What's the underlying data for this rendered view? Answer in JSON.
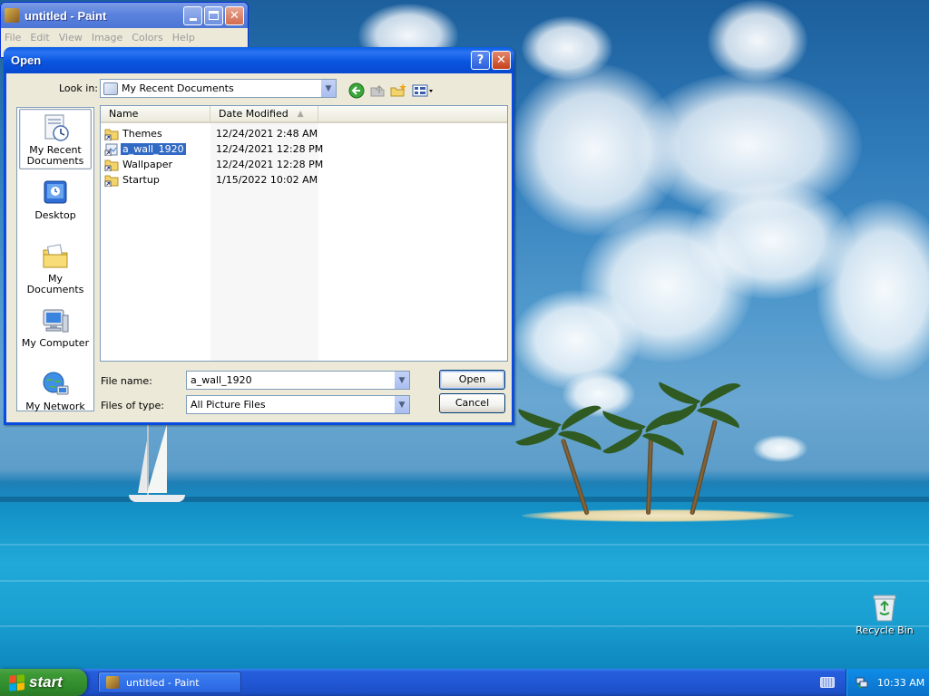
{
  "desktop": {
    "recycle_bin_label": "Recycle Bin"
  },
  "paint_window": {
    "title": "untitled - Paint",
    "menu": [
      "File",
      "Edit",
      "View",
      "Image",
      "Colors",
      "Help"
    ]
  },
  "open_dialog": {
    "title": "Open",
    "look_in_label": "Look in:",
    "look_in_value": "My Recent Documents",
    "places": [
      {
        "label": "My Recent Documents",
        "icon": "recent-documents-icon"
      },
      {
        "label": "Desktop",
        "icon": "desktop-icon"
      },
      {
        "label": "My Documents",
        "icon": "my-documents-icon"
      },
      {
        "label": "My Computer",
        "icon": "my-computer-icon"
      },
      {
        "label": "My Network",
        "icon": "my-network-icon"
      }
    ],
    "columns": {
      "name": "Name",
      "date_modified": "Date Modified"
    },
    "files": [
      {
        "name": "Themes",
        "date": "12/24/2021 2:48 AM",
        "selected": false
      },
      {
        "name": "a_wall_1920",
        "date": "12/24/2021 12:28 PM",
        "selected": true
      },
      {
        "name": "Wallpaper",
        "date": "12/24/2021 12:28 PM",
        "selected": false
      },
      {
        "name": "Startup",
        "date": "1/15/2022 10:02 AM",
        "selected": false
      }
    ],
    "file_name_label": "File name:",
    "file_name_value": "a_wall_1920",
    "files_of_type_label": "Files of type:",
    "files_of_type_value": "All Picture Files",
    "open_button": "Open",
    "cancel_button": "Cancel"
  },
  "taskbar": {
    "start_label": "start",
    "task_items": [
      "untitled - Paint"
    ],
    "clock": "10:33 AM"
  },
  "colors": {
    "xp_blue": "#0a56e0",
    "selection": "#316ac5",
    "start_green": "#3c9a36",
    "dialog_face": "#ece9d8"
  }
}
